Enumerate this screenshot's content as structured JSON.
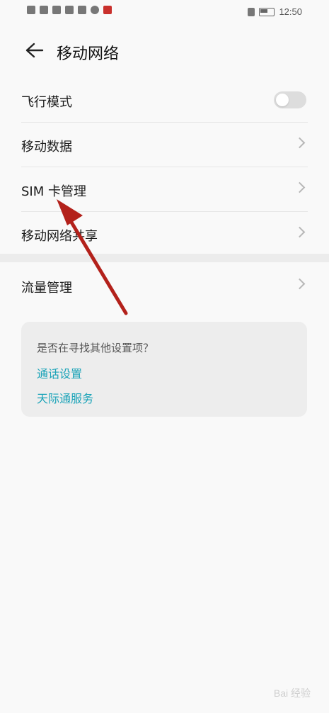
{
  "status_bar": {
    "time": "12:50"
  },
  "header": {
    "title": "移动网络"
  },
  "settings": {
    "airplane_mode": {
      "label": "飞行模式",
      "enabled": false
    },
    "mobile_data": "移动数据",
    "sim_manage": "SIM 卡管理",
    "hotspot": "移动网络共享",
    "data_usage": "流量管理"
  },
  "suggest": {
    "question": "是否在寻找其他设置项？",
    "links": [
      "通话设置",
      "天际通服务"
    ]
  },
  "colors": {
    "link": "#1aa3b8",
    "annotation_arrow": "#b3211b"
  },
  "watermark": "Bai 经验"
}
